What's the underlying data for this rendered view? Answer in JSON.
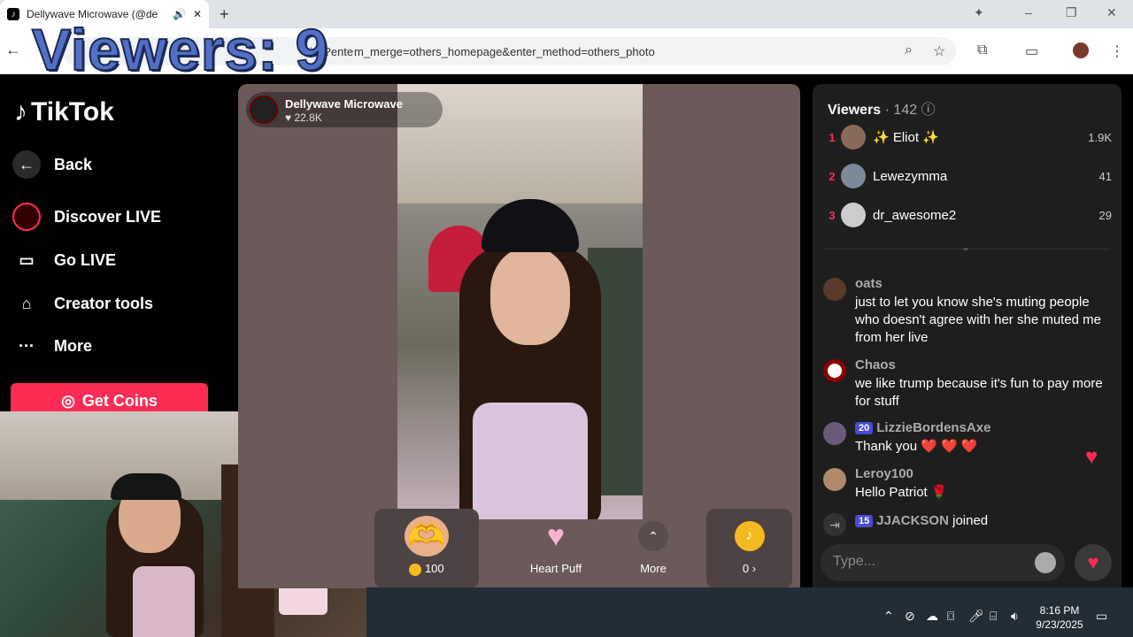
{
  "browser": {
    "tab_title": "Dellywave Microwave (@de",
    "tab_favicon": "tiktok-favicon",
    "new_tab": "+",
    "address_visible": "m_merge=others_homepage&enter_method=others_photo",
    "address_partial": "ive?ente",
    "window_controls": [
      "–",
      "❐",
      "✕"
    ]
  },
  "overlay_text": "Viewers: 9",
  "sidebar": {
    "logo": "TikTok",
    "items": [
      {
        "label": "Back",
        "icon": "arrow-left-icon"
      },
      {
        "label": "Discover LIVE",
        "icon": "live-avatar-icon"
      },
      {
        "label": "Go LIVE",
        "icon": "camera-icon"
      },
      {
        "label": "Creator tools",
        "icon": "creator-tools-icon"
      },
      {
        "label": "More",
        "icon": "more-dots-icon"
      }
    ],
    "get_coins": "Get Coins"
  },
  "stream": {
    "host_name": "Dellywave Microwave",
    "host_likes": "♥ 22.8K",
    "gifts": [
      {
        "label": "100",
        "icon": "heart-hands-gift-icon"
      },
      {
        "label": "Heart Puff",
        "icon": "heart-puff-icon"
      },
      {
        "label": "More",
        "icon": "chevron-up-icon"
      },
      {
        "label": "0 ›",
        "icon": "tiktok-coin-icon"
      }
    ]
  },
  "viewers_panel": {
    "title": "Viewers",
    "count": "· 142",
    "top": [
      {
        "rank": "1",
        "name": "✨ Eliot ✨",
        "score": "1.9K",
        "color": "#8a6a5a"
      },
      {
        "rank": "2",
        "name": "Lewezymma",
        "score": "41",
        "color": "#7a8a9a"
      },
      {
        "rank": "3",
        "name": "dr_awesome2",
        "score": "29",
        "color": "#cccccc"
      }
    ]
  },
  "chat": {
    "messages": [
      {
        "user": "oats",
        "text": "just to let you know she's muting people who doesn't agree with her she muted me from her live",
        "avatar_color": "#5a3a2a"
      },
      {
        "user": "Chaos",
        "text": "we like trump because it's fun to pay more for stuff",
        "avatar_color": "#8a0000"
      },
      {
        "user": "LizzieBordensAxe",
        "badge": "20",
        "text": "Thank you ❤️ ❤️ ❤️",
        "avatar_color": "#6a5a7a"
      },
      {
        "user": "Leroy100",
        "text": "Hello Patriot 🌹",
        "avatar_color": "#b08a6a"
      }
    ],
    "join": {
      "badge": "15",
      "user": "JJACKSON",
      "action": "joined"
    },
    "input_placeholder": "Type..."
  },
  "taskbar": {
    "time": "8:16 PM",
    "date": "9/23/2025"
  }
}
